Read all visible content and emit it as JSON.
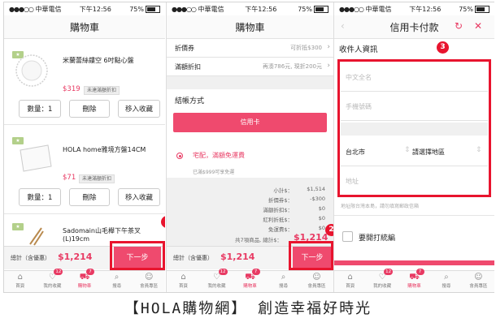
{
  "panel1": {
    "status": {
      "carrier": "中華電信",
      "time": "下午12:56",
      "battery": "75%"
    },
    "title": "購物車",
    "items": [
      {
        "name": "米蘭蕾絲鏤空 6吋點心盤",
        "price": "$319",
        "tag": "未達滿額折扣",
        "qty_label": "數量：1",
        "delete_label": "刪除",
        "fav_label": "移入收藏"
      },
      {
        "name": "HOLA home雅境方盤14CM",
        "price": "$71",
        "tag": "未達滿額折扣",
        "qty_label": "數量：1",
        "delete_label": "刪除",
        "fav_label": "移入收藏"
      },
      {
        "name": "Sadomain山毛櫸下午茶叉(L)19cm"
      }
    ],
    "total_label": "總計（含優惠）",
    "total_value": "$1,214",
    "next_label": "下一步",
    "step": "1"
  },
  "panel2": {
    "status": {
      "carrier": "中華電信",
      "time": "下午12:56",
      "battery": "75%"
    },
    "title": "購物車",
    "rows": [
      {
        "label": "折價券",
        "value": "可折抵$300"
      },
      {
        "label": "滿額折扣",
        "value": "再湊786元, 現折200元"
      }
    ],
    "payment_heading": "結帳方式",
    "pay_button": "信用卡",
    "delivery_label": "宅配，滿額免運費",
    "delivery_note": "已滿$999可享免運",
    "summary": [
      {
        "k": "小計$：",
        "v": "$1,514"
      },
      {
        "k": "折價券$：",
        "v": "-$300"
      },
      {
        "k": "滿額折扣$：",
        "v": "$0"
      },
      {
        "k": "紅利折抵$：",
        "v": "$0"
      },
      {
        "k": "免運費$：",
        "v": "$0"
      }
    ],
    "count_total": "共7項商品, 總計$：",
    "count_total_value": "$1,214",
    "total_label": "總計（含優惠）",
    "total_value": "$1,214",
    "next_label": "下一步",
    "step": "2"
  },
  "panel3": {
    "status": {
      "carrier": "中華電信",
      "time": "下午12:56",
      "battery": "75%"
    },
    "title": "信用卡付款",
    "section": "收件人資訊",
    "name_ph": "中文全名",
    "phone_ph": "手機號碼",
    "city": "台北市",
    "district": "請選擇地區",
    "address_ph": "地址",
    "note": "地址限台灣本島，請勿填寫郵政信箱",
    "invoice_label": "要開打統編",
    "step": "3"
  },
  "tabbar": [
    {
      "label": "首頁",
      "icon": "home-icon",
      "count": ""
    },
    {
      "label": "我的收藏",
      "icon": "heart-icon",
      "count": "12"
    },
    {
      "label": "購物車",
      "icon": "cart-icon",
      "count": "7"
    },
    {
      "label": "搜尋",
      "icon": "search-icon",
      "count": ""
    },
    {
      "label": "會員專區",
      "icon": "user-icon",
      "count": ""
    }
  ],
  "caption": {
    "open": "【",
    "brand": "HOLA購物網",
    "close": "】",
    "slogan": " 創造幸福好時光"
  },
  "colors": {
    "accent": "#ef4a6e",
    "highlight_box": "#e8142e",
    "price": "#e83a63"
  }
}
